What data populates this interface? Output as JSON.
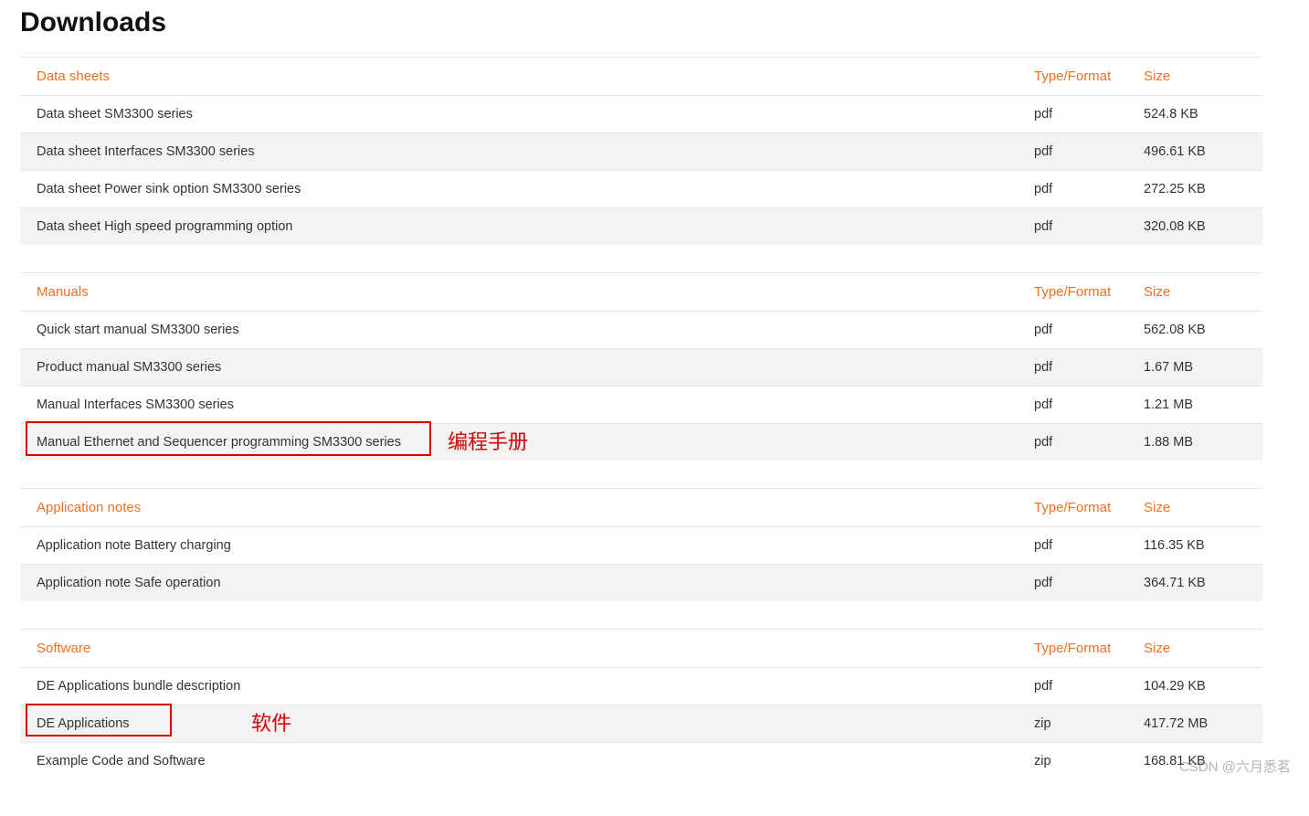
{
  "title": "Downloads",
  "columns": {
    "name_header_key": "",
    "type": "Type/Format",
    "size": "Size"
  },
  "sections": [
    {
      "header": "Data sheets",
      "rows": [
        {
          "name": "Data sheet SM3300 series",
          "type": "pdf",
          "size": "524.8 KB"
        },
        {
          "name": "Data sheet Interfaces SM3300 series",
          "type": "pdf",
          "size": "496.61 KB"
        },
        {
          "name": "Data sheet Power sink option SM3300 series",
          "type": "pdf",
          "size": "272.25 KB"
        },
        {
          "name": "Data sheet High speed programming option",
          "type": "pdf",
          "size": "320.08 KB"
        }
      ]
    },
    {
      "header": "Manuals",
      "rows": [
        {
          "name": "Quick start manual SM3300 series",
          "type": "pdf",
          "size": "562.08 KB"
        },
        {
          "name": "Product manual SM3300 series",
          "type": "pdf",
          "size": "1.67 MB"
        },
        {
          "name": "Manual Interfaces SM3300 series",
          "type": "pdf",
          "size": "1.21 MB"
        },
        {
          "name": "Manual Ethernet and Sequencer programming SM3300 series",
          "type": "pdf",
          "size": "1.88 MB"
        }
      ]
    },
    {
      "header": "Application notes",
      "rows": [
        {
          "name": "Application note Battery charging",
          "type": "pdf",
          "size": "116.35 KB"
        },
        {
          "name": "Application note Safe operation",
          "type": "pdf",
          "size": "364.71 KB"
        }
      ]
    },
    {
      "header": "Software",
      "rows": [
        {
          "name": "DE Applications bundle description",
          "type": "pdf",
          "size": "104.29 KB"
        },
        {
          "name": "DE Applications",
          "type": "zip",
          "size": "417.72 MB"
        },
        {
          "name": "Example Code and Software",
          "type": "zip",
          "size": "168.81 KB"
        }
      ]
    }
  ],
  "annotations": {
    "manual_label": "编程手册",
    "software_label": "软件"
  },
  "watermark": "CSDN @六月悉茗"
}
